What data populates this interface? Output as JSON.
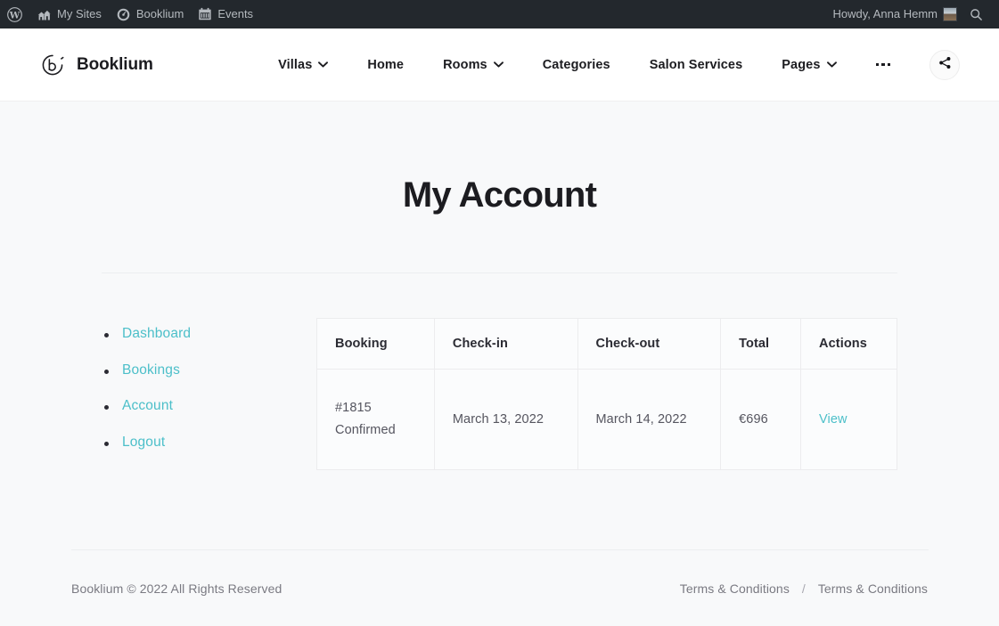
{
  "adminbar": {
    "items": [
      {
        "icon": "wordpress-logo-icon",
        "label": ""
      },
      {
        "icon": "my-sites-icon",
        "label": "My Sites"
      },
      {
        "icon": "dashboard-speedometer-icon",
        "label": "Booklium"
      },
      {
        "icon": "calendar-icon",
        "label": "Events"
      }
    ],
    "howdy": "Howdy, Anna Hemm",
    "avatar_name": "user-avatar",
    "search_icon": "search-icon"
  },
  "header": {
    "brand": "Booklium",
    "brand_icon": "booklium-logo-icon",
    "nav": [
      {
        "label": "Villas",
        "has_dropdown": true
      },
      {
        "label": "Home",
        "has_dropdown": false
      },
      {
        "label": "Rooms",
        "has_dropdown": true
      },
      {
        "label": "Categories",
        "has_dropdown": false
      },
      {
        "label": "Salon Services",
        "has_dropdown": false
      },
      {
        "label": "Pages",
        "has_dropdown": true
      }
    ],
    "more_icon": "more-horizontal-icon",
    "share_icon": "share-icon"
  },
  "main": {
    "title": "My Account",
    "account_nav": [
      {
        "label": "Dashboard"
      },
      {
        "label": "Bookings"
      },
      {
        "label": "Account"
      },
      {
        "label": "Logout"
      }
    ],
    "table": {
      "columns": [
        "Booking",
        "Check-in",
        "Check-out",
        "Total",
        "Actions"
      ],
      "rows": [
        {
          "booking_id": "#1815",
          "booking_status": "Confirmed",
          "checkin": "March 13, 2022",
          "checkout": "March 14, 2022",
          "total": "€696",
          "action": "View"
        }
      ]
    }
  },
  "footer": {
    "copyright": "Booklium © 2022 All Rights Reserved",
    "link1": "Terms & Conditions",
    "separator": "/",
    "link2": "Terms & Conditions"
  },
  "colors": {
    "accent": "#4cbfc9",
    "adminbar_bg": "#23282d",
    "page_bg": "#f8f9fa",
    "header_bg": "#ffffff",
    "text_dark": "#1c1c20",
    "text_muted": "#7a7a82"
  }
}
